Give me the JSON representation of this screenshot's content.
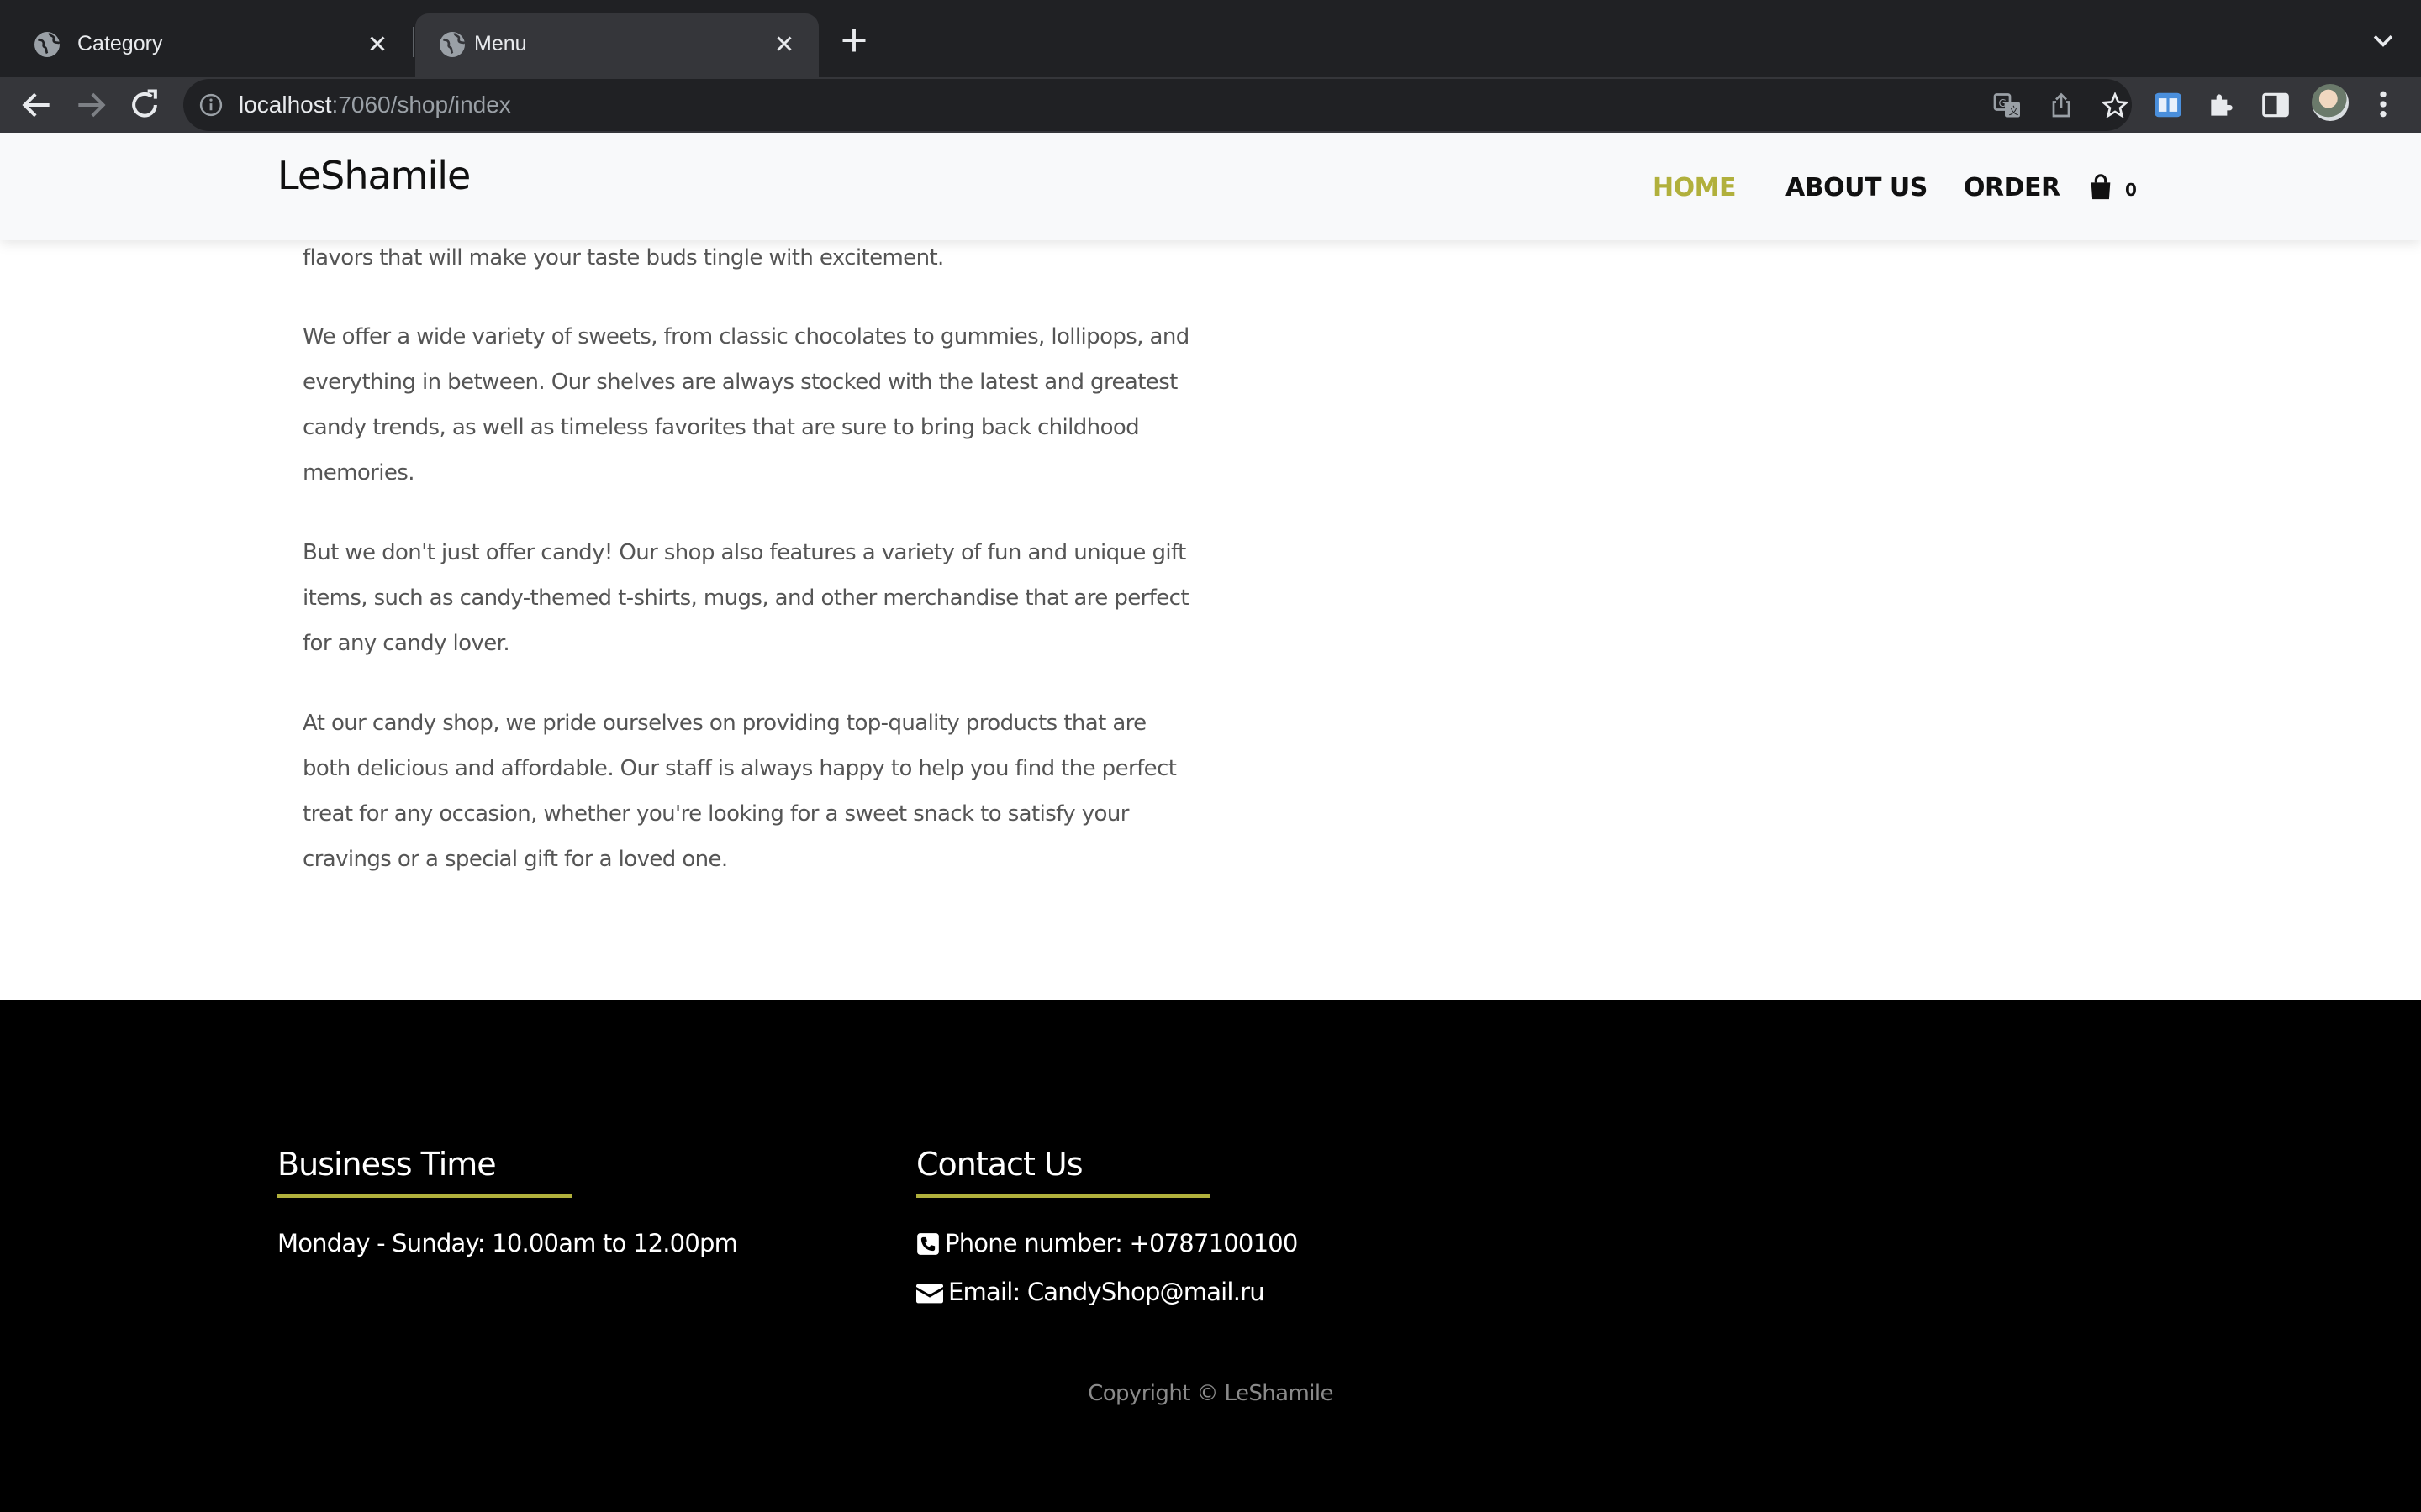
{
  "browser": {
    "tabs": [
      {
        "title": "Category",
        "active": false,
        "icon": "globe-icon"
      },
      {
        "title": "Menu",
        "active": true,
        "icon": "globe-icon"
      }
    ],
    "url_host": "localhost",
    "url_path": ":7060/shop/index"
  },
  "site": {
    "logo": "LeShamile",
    "nav": {
      "home": "HOME",
      "about": "ABOUT US",
      "order": "ORDER"
    },
    "cart_count": "0",
    "accent_color": "#b1b03c"
  },
  "content": {
    "paragraphs": [
      "flavors that will make your taste buds tingle with excitement.",
      "We offer a wide variety of sweets, from classic chocolates to gummies, lollipops, and everything in between. Our shelves are always stocked with the latest and greatest candy trends, as well as timeless favorites that are sure to bring back childhood memories.",
      "But we don't just offer candy! Our shop also features a variety of fun and unique gift items, such as candy-themed t-shirts, mugs, and other merchandise that are perfect for any candy lover.",
      "At our candy shop, we pride ourselves on providing top-quality products that are both delicious and affordable. Our staff is always happy to help you find the perfect treat for any occasion, whether you're looking for a sweet snack to satisfy your cravings or a special gift for a loved one."
    ]
  },
  "footer": {
    "business_heading": "Business Time",
    "business_hours": "Monday - Sunday: 10.00am to 12.00pm",
    "contact_heading": "Contact Us",
    "phone": "Phone number: +0787100100",
    "email": "Email: CandyShop@mail.ru",
    "copyright": "Copyright © LeShamile"
  }
}
